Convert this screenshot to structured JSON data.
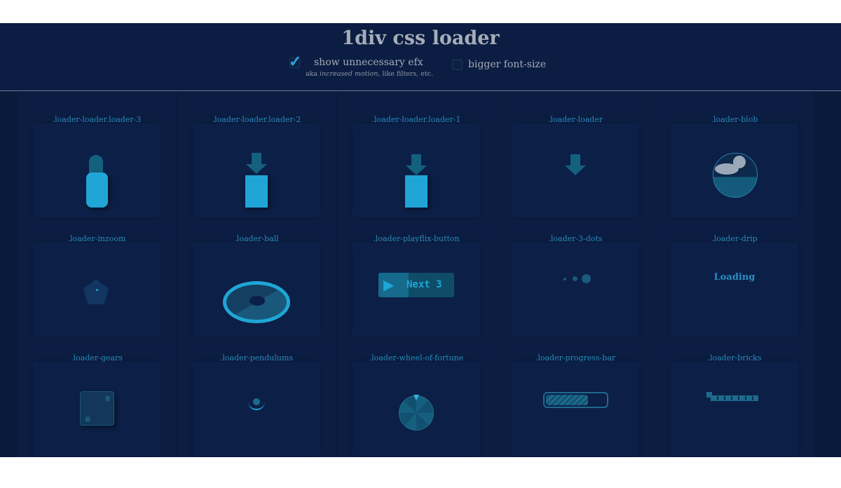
{
  "header": {
    "title": "1div css loader",
    "options": [
      {
        "label": "show unnecessary efx",
        "checked": true,
        "note_prefix": "aka ",
        "note_em": "increased motion",
        "note_suffix": ", like filters, etc."
      },
      {
        "label": "bigger font-size",
        "checked": false
      }
    ]
  },
  "loaders": [
    {
      "label": ".loader-loader.loader-3"
    },
    {
      "label": ".loader-loader.loader-2"
    },
    {
      "label": ".loader-loader.loader-1"
    },
    {
      "label": ".loader-loader"
    },
    {
      "label": ".loader-blob"
    },
    {
      "label": ".loader-inzoom"
    },
    {
      "label": ".loader-ball"
    },
    {
      "label": ".loader-playflix-button",
      "button_text": "Next 3"
    },
    {
      "label": ".loader-3-dots"
    },
    {
      "label": ".loader-drip",
      "text": "Loading"
    },
    {
      "label": ".loader-gears"
    },
    {
      "label": ".loader-pendulums"
    },
    {
      "label": ".loader-wheel-of-fortune"
    },
    {
      "label": ".loader-progress-bar",
      "progress": 0.7
    },
    {
      "label": ".loader-bricks"
    }
  ],
  "colors": {
    "accent": "#1fa6d6",
    "background": "#0a1a3b",
    "card": "#0c1f46",
    "title": "#a6adb8"
  }
}
